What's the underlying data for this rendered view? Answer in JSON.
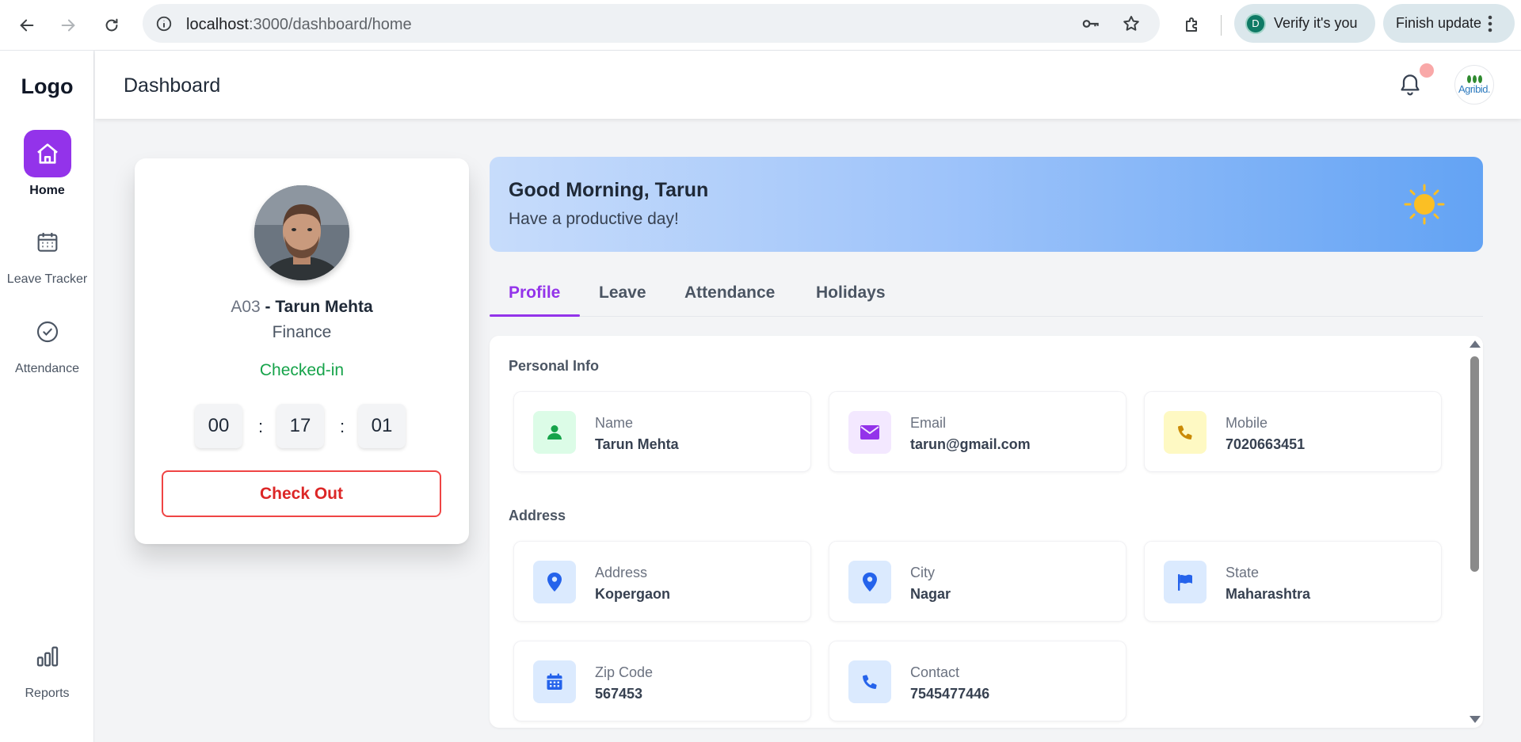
{
  "browser": {
    "url_host": "localhost",
    "url_path": ":3000/dashboard/home",
    "verify_label": "Verify it's you",
    "verify_avatar_letter": "D",
    "update_label": "Finish update"
  },
  "sidebar": {
    "logo": "Logo",
    "items": [
      {
        "label": "Home",
        "icon": "home-icon",
        "active": true
      },
      {
        "label": "Leave Tracker",
        "icon": "calendar-icon",
        "active": false
      },
      {
        "label": "Attendance",
        "icon": "check-circle-icon",
        "active": false
      },
      {
        "label": "Reports",
        "icon": "bar-chart-icon",
        "active": false
      }
    ]
  },
  "header": {
    "title": "Dashboard",
    "user_logo_text": "Agribid."
  },
  "profile": {
    "code": "A03",
    "separator": "-",
    "name": "Tarun Mehta",
    "department": "Finance",
    "status": "Checked-in",
    "timer": {
      "hours": "00",
      "minutes": "17",
      "seconds": "01",
      "sep": ":"
    },
    "checkout_label": "Check Out"
  },
  "banner": {
    "greeting": "Good Morning, Tarun",
    "subtitle": "Have a productive day!"
  },
  "tabs": [
    {
      "label": "Profile",
      "active": true
    },
    {
      "label": "Leave",
      "active": false
    },
    {
      "label": "Attendance",
      "active": false
    },
    {
      "label": "Holidays",
      "active": false
    }
  ],
  "personal_info": {
    "title": "Personal Info",
    "fields": [
      {
        "label": "Name",
        "value": "Tarun Mehta",
        "icon": "user-icon",
        "color": "#16a34a",
        "bg": "#dcfce7"
      },
      {
        "label": "Email",
        "value": "tarun@gmail.com",
        "icon": "envelope-icon",
        "color": "#9333ea",
        "bg": "#f3e8ff"
      },
      {
        "label": "Mobile",
        "value": "7020663451",
        "icon": "phone-icon",
        "color": "#ca8a04",
        "bg": "#fef9c3"
      }
    ]
  },
  "address": {
    "title": "Address",
    "fields": [
      {
        "label": "Address",
        "value": "Kopergaon",
        "icon": "map-pin-icon",
        "color": "#2563eb",
        "bg": "#dbeafe"
      },
      {
        "label": "City",
        "value": "Nagar",
        "icon": "map-pin-icon",
        "color": "#2563eb",
        "bg": "#dbeafe"
      },
      {
        "label": "State",
        "value": "Maharashtra",
        "icon": "flag-icon",
        "color": "#2563eb",
        "bg": "#dbeafe"
      },
      {
        "label": "Zip Code",
        "value": "567453",
        "icon": "calendar-icon",
        "color": "#2563eb",
        "bg": "#dbeafe"
      },
      {
        "label": "Contact",
        "value": "7545477446",
        "icon": "phone-icon",
        "color": "#2563eb",
        "bg": "#dbeafe"
      }
    ]
  }
}
